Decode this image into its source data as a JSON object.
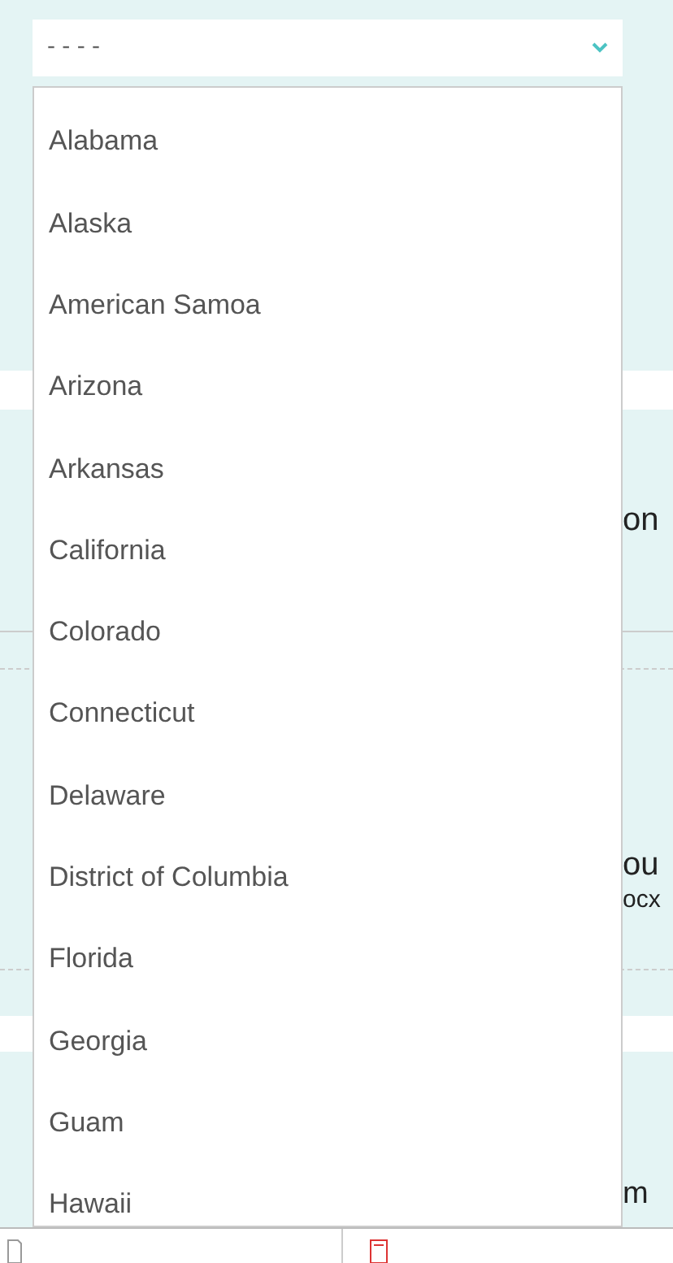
{
  "select": {
    "value": "- - - -",
    "expanded": true,
    "options": [
      {
        "label": "Alabama",
        "selected": false
      },
      {
        "label": "Alaska",
        "selected": false
      },
      {
        "label": "American Samoa",
        "selected": false
      },
      {
        "label": "Arizona",
        "selected": false
      },
      {
        "label": "Arkansas",
        "selected": false
      },
      {
        "label": "California",
        "selected": false
      },
      {
        "label": "Colorado",
        "selected": false
      },
      {
        "label": "Connecticut",
        "selected": false
      },
      {
        "label": "Delaware",
        "selected": false
      },
      {
        "label": "District of Columbia",
        "selected": false
      },
      {
        "label": "Florida",
        "selected": false
      },
      {
        "label": "Georgia",
        "selected": false
      },
      {
        "label": "Guam",
        "selected": false
      },
      {
        "label": "Hawaii",
        "selected": false
      }
    ]
  },
  "background_texts": {
    "heading": "on",
    "title": "ou",
    "file": "ocx",
    "footer": "m"
  }
}
